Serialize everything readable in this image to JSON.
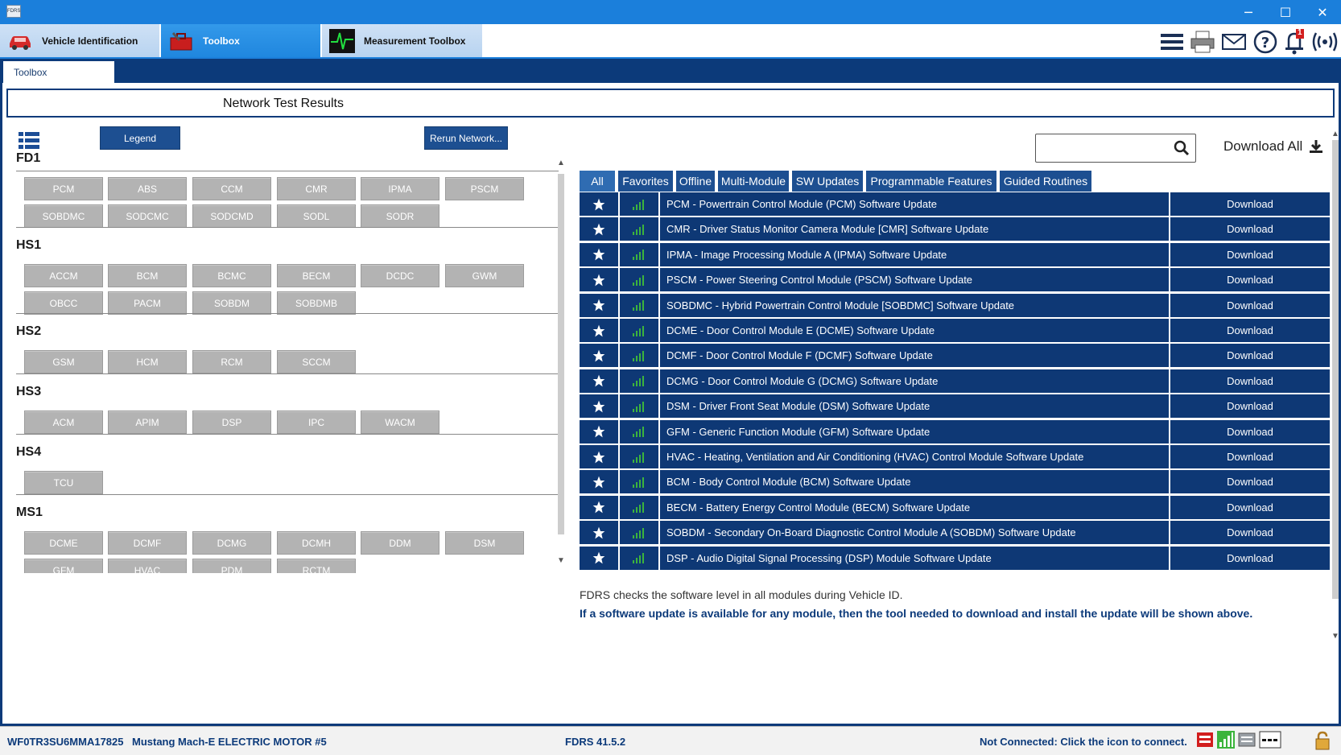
{
  "window": {
    "app_icon_label": "FDRS",
    "minimize_glyph": "─",
    "maximize_glyph": "☐",
    "close_glyph": "✕"
  },
  "top_tabs": [
    {
      "label": "Vehicle Identification",
      "icon": "car-icon"
    },
    {
      "label": "Toolbox",
      "icon": "toolbox-icon"
    },
    {
      "label": "Measurement Toolbox",
      "icon": "oscilloscope-icon"
    }
  ],
  "header_icons": [
    "menu-icon",
    "printer-icon",
    "mail-icon",
    "help-icon",
    "bell-icon",
    "wireless-icon"
  ],
  "notification_count": "1",
  "sub_tab": "Toolbox",
  "page_title": "Network Test Results",
  "left": {
    "legend_label": "Legend",
    "rerun_label": "Rerun Network...",
    "networks": [
      {
        "name": "FD1",
        "modules": [
          "PCM",
          "ABS",
          "CCM",
          "CMR",
          "IPMA",
          "PSCM",
          "SOBDMC",
          "SODCMC",
          "SODCMD",
          "SODL",
          "SODR"
        ]
      },
      {
        "name": "HS1",
        "modules": [
          "ACCM",
          "BCM",
          "BCMC",
          "BECM",
          "DCDC",
          "GWM",
          "OBCC",
          "PACM",
          "SOBDM",
          "SOBDMB"
        ]
      },
      {
        "name": "HS2",
        "modules": [
          "GSM",
          "HCM",
          "RCM",
          "SCCM"
        ]
      },
      {
        "name": "HS3",
        "modules": [
          "ACM",
          "APIM",
          "DSP",
          "IPC",
          "WACM"
        ]
      },
      {
        "name": "HS4",
        "modules": [
          "TCU"
        ]
      },
      {
        "name": "MS1",
        "modules": [
          "DCME",
          "DCMF",
          "DCMG",
          "DCMH",
          "DDM",
          "DSM",
          "GFM",
          "HVAC",
          "PDM",
          "RCTM"
        ]
      }
    ]
  },
  "right": {
    "search_placeholder": "",
    "download_all_label": "Download All",
    "filter_tabs": [
      "All",
      "Favorites",
      "Offline",
      "Multi-Module",
      "SW Updates",
      "Programmable Features",
      "Guided Routines"
    ],
    "active_filter": "All",
    "download_label": "Download",
    "items": [
      "PCM - Powertrain Control Module (PCM) Software Update",
      "CMR - Driver Status Monitor Camera Module [CMR] Software Update",
      "IPMA - Image Processing Module A (IPMA) Software Update",
      "PSCM - Power Steering Control Module (PSCM) Software Update",
      "SOBDMC - Hybrid Powertrain Control Module [SOBDMC] Software Update",
      "DCME - Door Control Module E (DCME) Software Update",
      "DCMF - Door Control Module F (DCMF) Software Update",
      "DCMG - Door Control Module G (DCMG) Software Update",
      "DSM - Driver Front Seat Module (DSM) Software Update",
      "GFM - Generic Function Module (GFM) Software Update",
      "HVAC - Heating, Ventilation and Air Conditioning (HVAC) Control Module Software Update",
      "BCM - Body Control Module (BCM) Software Update",
      "BECM - Battery Energy Control Module (BECM) Software Update",
      "SOBDM - Secondary On-Board Diagnostic Control Module A (SOBDM) Software Update",
      "DSP - Audio Digital Signal Processing (DSP) Module Software Update"
    ],
    "note_line1": "FDRS checks the software level in all modules during Vehicle ID.",
    "note_line2": "If a software update is available for any module, then the tool needed to download and install the update will be shown above."
  },
  "status": {
    "vin": "WF0TR3SU6MMA17825",
    "vehicle": "Mustang Mach-E ELECTRIC MOTOR #5",
    "version": "FDRS 41.5.2",
    "connection": "Not Connected: Click the icon to connect."
  },
  "colors": {
    "navy": "#0e3875",
    "blue": "#1b7fdb",
    "signal_green": "#3cb43c",
    "alert_red": "#d21e1e"
  }
}
